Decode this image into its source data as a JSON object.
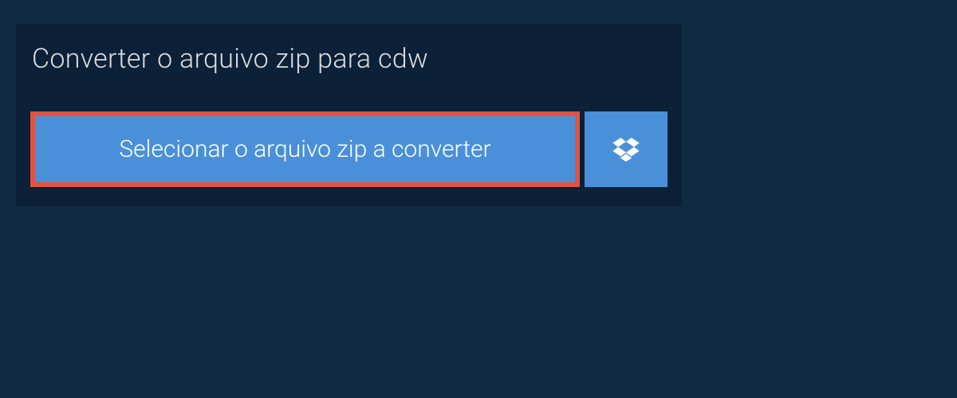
{
  "title": "Converter o arquivo zip para cdw",
  "buttons": {
    "select_file": "Selecionar o arquivo zip a converter"
  },
  "colors": {
    "page_bg": "#122b45",
    "panel_bg": "#0c2038",
    "button_bg": "#4a90d9",
    "highlight_border": "#e15241",
    "text_light": "#d9dde0",
    "text_white": "#ffffff"
  }
}
